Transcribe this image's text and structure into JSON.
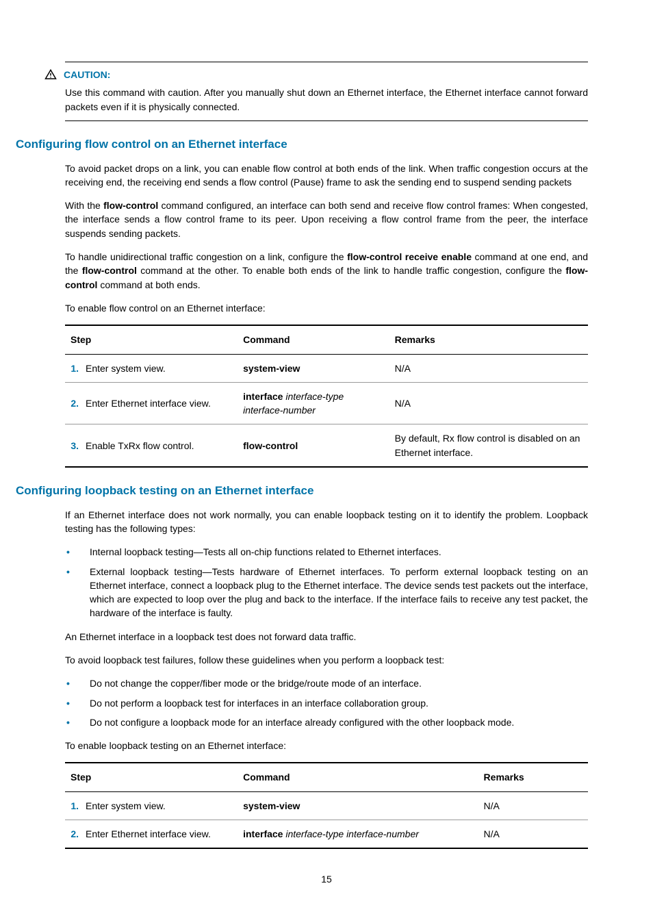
{
  "caution": {
    "label": "CAUTION:",
    "text": "Use this command with caution. After you manually shut down an Ethernet interface, the Ethernet interface cannot forward packets even if it is physically connected."
  },
  "section1": {
    "heading": "Configuring flow control on an Ethernet interface",
    "para1": "To avoid packet drops on a link, you can enable flow control at both ends of the link. When traffic congestion occurs at the receiving end, the receiving end sends a flow control (Pause) frame to ask the sending end to suspend sending packets",
    "para2_pre": "With the ",
    "para2_bold1": "flow-control",
    "para2_mid": " command configured, an interface can both send and receive flow control frames: When congested, the interface sends a flow control frame to its peer. Upon receiving a flow control frame from the peer, the interface suspends sending packets.",
    "para3_a": "To handle unidirectional traffic congestion on a link, configure the ",
    "para3_b": "flow-control receive enable",
    "para3_c": " command at one end, and the ",
    "para3_d": "flow-control",
    "para3_e": " command at the other. To enable both ends of the link to handle traffic congestion, configure the ",
    "para3_f": "flow-control",
    "para3_g": " command at both ends.",
    "para4": "To enable flow control on an Ethernet interface:"
  },
  "table1": {
    "headers": {
      "step": "Step",
      "command": "Command",
      "remarks": "Remarks"
    },
    "rows": [
      {
        "num": "1.",
        "step": "Enter system view.",
        "cmd_bold": "system-view",
        "cmd_italic": "",
        "remarks": "N/A"
      },
      {
        "num": "2.",
        "step": "Enter Ethernet interface view.",
        "cmd_bold": "interface",
        "cmd_italic": " interface-type interface-number",
        "remarks": "N/A"
      },
      {
        "num": "3.",
        "step": "Enable TxRx flow control.",
        "cmd_bold": "flow-control",
        "cmd_italic": "",
        "remarks": "By default, Rx flow control is disabled on an Ethernet interface."
      }
    ]
  },
  "section2": {
    "heading": "Configuring loopback testing on an Ethernet interface",
    "para1": "If an Ethernet interface does not work normally, you can enable loopback testing on it to identify the problem. Loopback testing has the following types:",
    "bullet1_b": "Internal loopback testing",
    "bullet1_t": "—Tests all on-chip functions related to Ethernet interfaces.",
    "bullet2_b": "External loopback testing",
    "bullet2_t": "—Tests hardware of Ethernet interfaces. To perform external loopback testing on an Ethernet interface, connect a loopback plug to the Ethernet interface. The device sends test packets out the interface, which are expected to loop over the plug and back to the interface. If the interface fails to receive any test packet, the hardware of the interface is faulty.",
    "para2": "An Ethernet interface in a loopback test does not forward data traffic.",
    "para3": "To avoid loopback test failures, follow these guidelines when you perform a loopback test:",
    "g1": "Do not change the copper/fiber mode or the bridge/route mode of an interface.",
    "g2": "Do not perform a loopback test for interfaces in an interface collaboration group.",
    "g3": "Do not configure a loopback mode for an interface already configured with the other loopback mode.",
    "para4": "To enable loopback testing on an Ethernet interface:"
  },
  "table2": {
    "headers": {
      "step": "Step",
      "command": "Command",
      "remarks": "Remarks"
    },
    "rows": [
      {
        "num": "1.",
        "step": "Enter system view.",
        "cmd_bold": "system-view",
        "cmd_italic": "",
        "remarks": "N/A"
      },
      {
        "num": "2.",
        "step": "Enter Ethernet interface view.",
        "cmd_bold": "interface",
        "cmd_italic": " interface-type interface-number",
        "remarks": "N/A"
      }
    ]
  },
  "page_number": "15"
}
